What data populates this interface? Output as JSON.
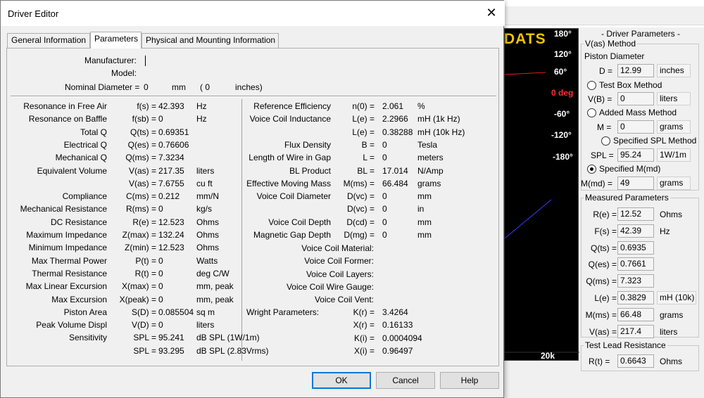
{
  "background_app": {
    "graph": {
      "brand_text": "DATS",
      "y_ticks": [
        "180°",
        "120°",
        "60°",
        "0 deg",
        "-60°",
        "-120°",
        "-180°"
      ],
      "x_tick": "20k"
    },
    "driver_parameters_panel": {
      "title": "- Driver Parameters -",
      "vas_method": {
        "legend": "V(as) Method",
        "piston_label": "Piston Diameter",
        "d_label": "D =",
        "d_value": "12.99",
        "d_unit": "inches",
        "test_box": "Test Box Method",
        "vb_label": "V(B) =",
        "vb_value": "0",
        "vb_unit": "liters",
        "added_mass": "Added Mass Method",
        "m_label": "M =",
        "m_value": "0",
        "m_unit": "grams",
        "spl_method": "Specified SPL Method",
        "spl_label": "SPL =",
        "spl_value": "95.24",
        "spl_unit": "1W/1m",
        "mmd_method": "Specified M(md)",
        "mmd_label": "M(md) =",
        "mmd_value": "49",
        "mmd_unit": "grams"
      },
      "measured": {
        "legend": "Measured Parameters",
        "rows": [
          {
            "label": "R(e) =",
            "value": "12.52",
            "unit": "Ohms"
          },
          {
            "label": "F(s) =",
            "value": "42.39",
            "unit": "Hz"
          },
          {
            "label": "Q(ts) =",
            "value": "0.6935",
            "unit": ""
          },
          {
            "label": "Q(es) =",
            "value": "0.7661",
            "unit": ""
          },
          {
            "label": "Q(ms) =",
            "value": "7.323",
            "unit": ""
          },
          {
            "label": "L(e) =",
            "value": "0.3829",
            "unit": "mH (10k)"
          },
          {
            "label": "M(ms) =",
            "value": "66.48",
            "unit": "grams"
          },
          {
            "label": "V(as) =",
            "value": "217.4",
            "unit": "liters"
          }
        ]
      },
      "test_lead": {
        "legend": "Test Lead Resistance",
        "label": "R(t) =",
        "value": "0.6643",
        "unit": "Ohms"
      }
    }
  },
  "dialog": {
    "title": "Driver Editor",
    "tabs": [
      "General Information",
      "Parameters",
      "Physical and Mounting Information"
    ],
    "header": {
      "manufacturer_label": "Manufacturer:",
      "model_label": "Model:",
      "nominal_label": "Nominal Diameter =",
      "nominal_mm": "0",
      "mm_unit": "mm",
      "nominal_in": "( 0",
      "in_unit": "inches)"
    },
    "left_params": [
      {
        "name": "Resonance in Free Air",
        "sym": "f(s) =",
        "val": "42.393",
        "unit": "Hz"
      },
      {
        "name": "Resonance on Baffle",
        "sym": "f(sb) =",
        "val": "0",
        "unit": "Hz"
      },
      {
        "name": "Total Q",
        "sym": "Q(ts) =",
        "val": "0.69351",
        "unit": ""
      },
      {
        "name": "Electrical Q",
        "sym": "Q(es) =",
        "val": "0.76606",
        "unit": ""
      },
      {
        "name": "Mechanical Q",
        "sym": "Q(ms) =",
        "val": "7.3234",
        "unit": ""
      },
      {
        "name": "Equivalent Volume",
        "sym": "V(as) =",
        "val": "217.35",
        "unit": "liters"
      },
      {
        "name": "",
        "sym": "V(as) =",
        "val": "7.6755",
        "unit": "cu ft"
      },
      {
        "name": "Compliance",
        "sym": "C(ms) =",
        "val": "0.212",
        "unit": "mm/N"
      },
      {
        "name": "Mechanical Resistance",
        "sym": "R(ms) =",
        "val": "0",
        "unit": "kg/s"
      },
      {
        "name": "DC Resistance",
        "sym": "R(e) =",
        "val": "12.523",
        "unit": "Ohms"
      },
      {
        "name": "Maximum Impedance",
        "sym": "Z(max) =",
        "val": "132.24",
        "unit": "Ohms"
      },
      {
        "name": "Minimum Impedance",
        "sym": "Z(min) =",
        "val": "12.523",
        "unit": "Ohms"
      },
      {
        "name": "Max Thermal Power",
        "sym": "P(t) =",
        "val": "0",
        "unit": "Watts"
      },
      {
        "name": "Thermal Resistance",
        "sym": "R(t) =",
        "val": "0",
        "unit": "deg C/W"
      },
      {
        "name": "Max Linear Excursion",
        "sym": "X(max) =",
        "val": "0",
        "unit": "mm, peak"
      },
      {
        "name": "Max Excursion",
        "sym": "X(peak) =",
        "val": "0",
        "unit": "mm, peak"
      },
      {
        "name": "Piston Area",
        "sym": "S(D) =",
        "val": "0.085504",
        "unit": "sq m"
      },
      {
        "name": "Peak Volume Displ",
        "sym": "V(D) =",
        "val": "0",
        "unit": "liters"
      },
      {
        "name": "Sensitivity",
        "sym": "SPL =",
        "val": "95.241",
        "unit": "dB SPL (1W/1m)"
      },
      {
        "name": "",
        "sym": "SPL =",
        "val": "93.295",
        "unit": "dB SPL (2.83Vrms)"
      }
    ],
    "right_params": [
      {
        "name": "Reference Efficiency",
        "sym": "n(0) =",
        "val": "2.061",
        "unit": "%"
      },
      {
        "name": "Voice Coil Inductance",
        "sym": "L(e) =",
        "val": "2.2966",
        "unit": "mH (1k Hz)"
      },
      {
        "name": "",
        "sym": "L(e) =",
        "val": "0.38288",
        "unit": "mH (10k Hz)"
      },
      {
        "name": "Flux Density",
        "sym": "B =",
        "val": "0",
        "unit": "Tesla"
      },
      {
        "name": "Length of Wire in Gap",
        "sym": "L =",
        "val": "0",
        "unit": "meters"
      },
      {
        "name": "BL Product",
        "sym": "BL =",
        "val": "17.014",
        "unit": "N/Amp"
      },
      {
        "name": "Effective Moving Mass",
        "sym": "M(ms) =",
        "val": "66.484",
        "unit": "grams"
      },
      {
        "name": "Voice Coil Diameter",
        "sym": "D(vc) =",
        "val": "0",
        "unit": "mm"
      },
      {
        "name": "",
        "sym": "D(vc) =",
        "val": "0",
        "unit": "in"
      },
      {
        "name": "Voice Coil Depth",
        "sym": "D(cd) =",
        "val": "0",
        "unit": "mm"
      },
      {
        "name": "Magnetic Gap Depth",
        "sym": "D(mg) =",
        "val": "0",
        "unit": "mm"
      }
    ],
    "voice_coil_text": [
      "Voice Coil Material:",
      "Voice Coil Former:",
      "Voice Coil Layers:",
      "Voice Coil Wire Gauge:",
      "Voice Coil Vent:"
    ],
    "wright": {
      "label": "Wright Parameters:",
      "rows": [
        {
          "sym": "K(r) =",
          "val": "3.4264"
        },
        {
          "sym": "X(r) =",
          "val": "0.16133"
        },
        {
          "sym": "K(i) =",
          "val": "0.0004094"
        },
        {
          "sym": "X(i) =",
          "val": "0.96497"
        }
      ]
    },
    "buttons": {
      "ok": "OK",
      "cancel": "Cancel",
      "help": "Help"
    },
    "close_glyph": "✕"
  }
}
